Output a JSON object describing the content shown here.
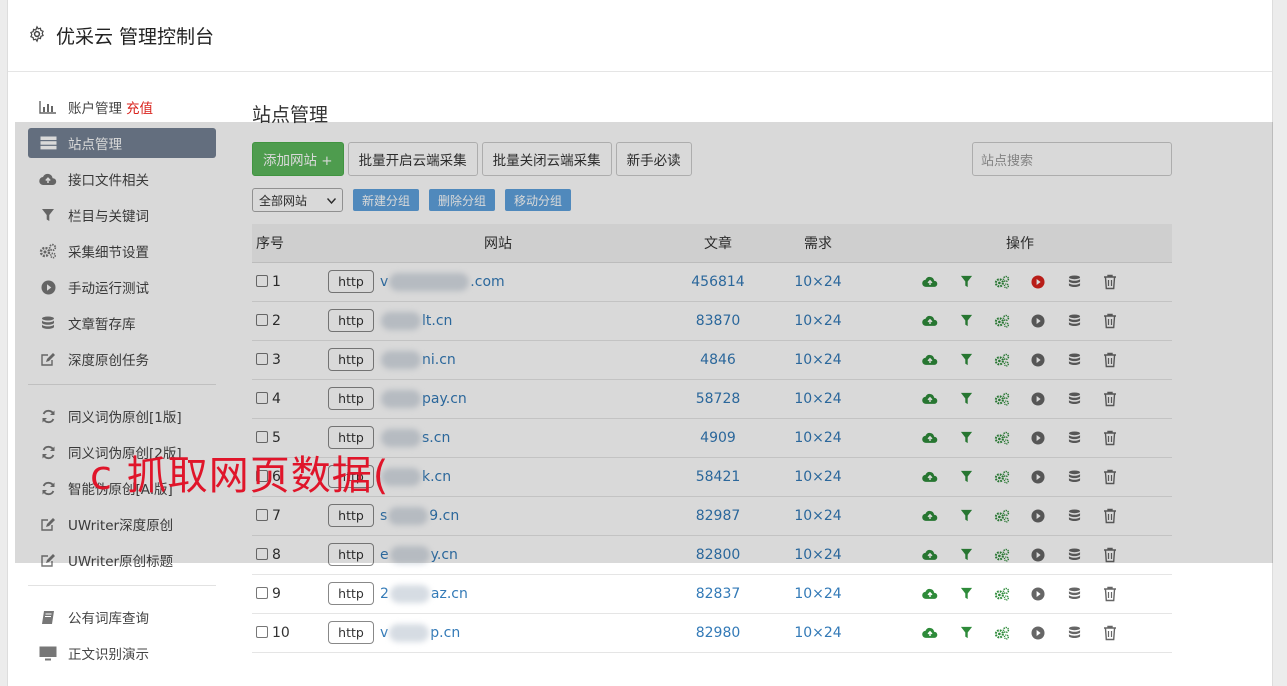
{
  "header": {
    "title": "优采云 管理控制台",
    "icon": "gear-icon"
  },
  "sidebar": {
    "group1": [
      {
        "label": "账户管理",
        "extra": "充值",
        "icon": "bar-chart-icon"
      },
      {
        "label": "站点管理",
        "icon": "server-list-icon",
        "active": true
      },
      {
        "label": "接口文件相关",
        "icon": "cloud-upload-icon"
      },
      {
        "label": "栏目与关键词",
        "icon": "filter-icon"
      },
      {
        "label": "采集细节设置",
        "icon": "gears-icon"
      },
      {
        "label": "手动运行测试",
        "icon": "play-circle-icon"
      },
      {
        "label": "文章暂存库",
        "icon": "database-icon"
      },
      {
        "label": "深度原创任务",
        "icon": "edit-icon"
      }
    ],
    "group2": [
      {
        "label": "同义词伪原创[1版]",
        "icon": "refresh-icon"
      },
      {
        "label": "同义词伪原创[2版]",
        "icon": "refresh-icon"
      },
      {
        "label": "智能伪原创[AI版]",
        "icon": "refresh-icon"
      },
      {
        "label": "UWriter深度原创",
        "icon": "edit-icon"
      },
      {
        "label": "UWriter原创标题",
        "icon": "edit-icon"
      }
    ],
    "group3": [
      {
        "label": "公有词库查询",
        "icon": "book-icon"
      },
      {
        "label": "正文识别演示",
        "icon": "monitor-icon"
      }
    ]
  },
  "main": {
    "title": "站点管理",
    "buttons": {
      "add": "添加网站 +",
      "batch_on": "批量开启云端采集",
      "batch_off": "批量关闭云端采集",
      "guide": "新手必读"
    },
    "search_placeholder": "站点搜索",
    "group_select": "全部网站",
    "group_buttons": {
      "new": "新建分组",
      "delete": "删除分组",
      "move": "移动分组"
    },
    "columns": [
      "序号",
      "网站",
      "文章",
      "需求",
      "操作"
    ],
    "rows": [
      {
        "idx": "1",
        "protocol": "http",
        "pre": "v",
        "post": ".com",
        "articles": "456814",
        "demand": "10×24",
        "running": true
      },
      {
        "idx": "2",
        "protocol": "http",
        "pre": "",
        "post": "lt.cn",
        "articles": "83870",
        "demand": "10×24",
        "running": false
      },
      {
        "idx": "3",
        "protocol": "http",
        "pre": "",
        "post": "ni.cn",
        "articles": "4846",
        "demand": "10×24",
        "running": false
      },
      {
        "idx": "4",
        "protocol": "http",
        "pre": "",
        "post": "pay.cn",
        "articles": "58728",
        "demand": "10×24",
        "running": false
      },
      {
        "idx": "5",
        "protocol": "http",
        "pre": "",
        "post": "s.cn",
        "articles": "4909",
        "demand": "10×24",
        "running": false
      },
      {
        "idx": "6",
        "protocol": "http",
        "pre": "",
        "post": "k.cn",
        "articles": "58421",
        "demand": "10×24",
        "running": false
      },
      {
        "idx": "7",
        "protocol": "http",
        "pre": "s",
        "post": "9.cn",
        "articles": "82987",
        "demand": "10×24",
        "running": false
      },
      {
        "idx": "8",
        "protocol": "http",
        "pre": "e",
        "post": "y.cn",
        "articles": "82800",
        "demand": "10×24",
        "running": false
      },
      {
        "idx": "9",
        "protocol": "http",
        "pre": "2",
        "post": "az.cn",
        "articles": "82837",
        "demand": "10×24",
        "running": false
      },
      {
        "idx": "10",
        "protocol": "http",
        "pre": "v",
        "post": "p.cn",
        "articles": "82980",
        "demand": "10×24",
        "running": false
      }
    ]
  },
  "overlay": {
    "text": "c 抓取网页数据("
  },
  "colors": {
    "active_nav": "#758294",
    "green": "#5cb85c",
    "link": "#337ab7",
    "charge": "#d9231d",
    "run": "#d9231d",
    "icon_green": "#2e8b3a"
  }
}
